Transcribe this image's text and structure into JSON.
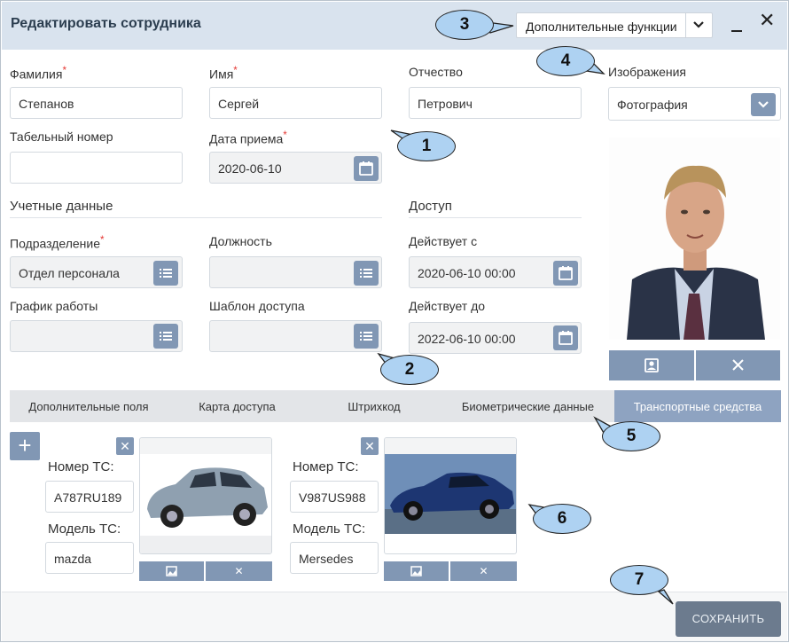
{
  "window": {
    "title": "Редактировать сотрудника",
    "functions_label": "Дополнительные функции"
  },
  "form": {
    "last_name_label": "Фамилия",
    "last_name_value": "Степанов",
    "first_name_label": "Имя",
    "first_name_value": "Сергей",
    "middle_name_label": "Отчество",
    "middle_name_value": "Петрович",
    "personnel_number_label": "Табельный номер",
    "personnel_number_value": "",
    "hire_date_label": "Дата приема",
    "hire_date_value": "2020-06-10",
    "account_section": "Учетные данные",
    "access_section": "Доступ",
    "department_label": "Подразделение",
    "department_value": "Отдел персонала",
    "position_label": "Должность",
    "position_value": "",
    "schedule_label": "График работы",
    "schedule_value": "",
    "access_template_label": "Шаблон доступа",
    "access_template_value": "",
    "valid_from_label": "Действует с",
    "valid_from_value": "2020-06-10 00:00",
    "valid_to_label": "Действует до",
    "valid_to_value": "2022-06-10 00:00",
    "required_mark": "*"
  },
  "images": {
    "label": "Изображения",
    "selected": "Фотография"
  },
  "tabs": [
    {
      "label": "Дополнительные поля"
    },
    {
      "label": "Карта доступа"
    },
    {
      "label": "Штрихкод"
    },
    {
      "label": "Биометрические данные"
    },
    {
      "label": "Транспортные средства"
    }
  ],
  "vehicles": [
    {
      "plate_label": "Номер ТС:",
      "plate_value": "А787RU189",
      "model_label": "Модель ТС:",
      "model_value": "mazda"
    },
    {
      "plate_label": "Номер ТС:",
      "plate_value": "V987US988",
      "model_label": "Модель ТС:",
      "model_value": "Mersedes"
    }
  ],
  "footer": {
    "save_label": "СОХРАНИТЬ"
  },
  "callouts": [
    "1",
    "2",
    "3",
    "4",
    "5",
    "6",
    "7"
  ],
  "colors": {
    "titlebar": "#d9e3ee",
    "accent_button": "#8197b4",
    "active_tab": "#8ea3c1",
    "save_button": "#6c7b8e",
    "callout_fill": "#aed2f2",
    "required": "#e53935"
  }
}
